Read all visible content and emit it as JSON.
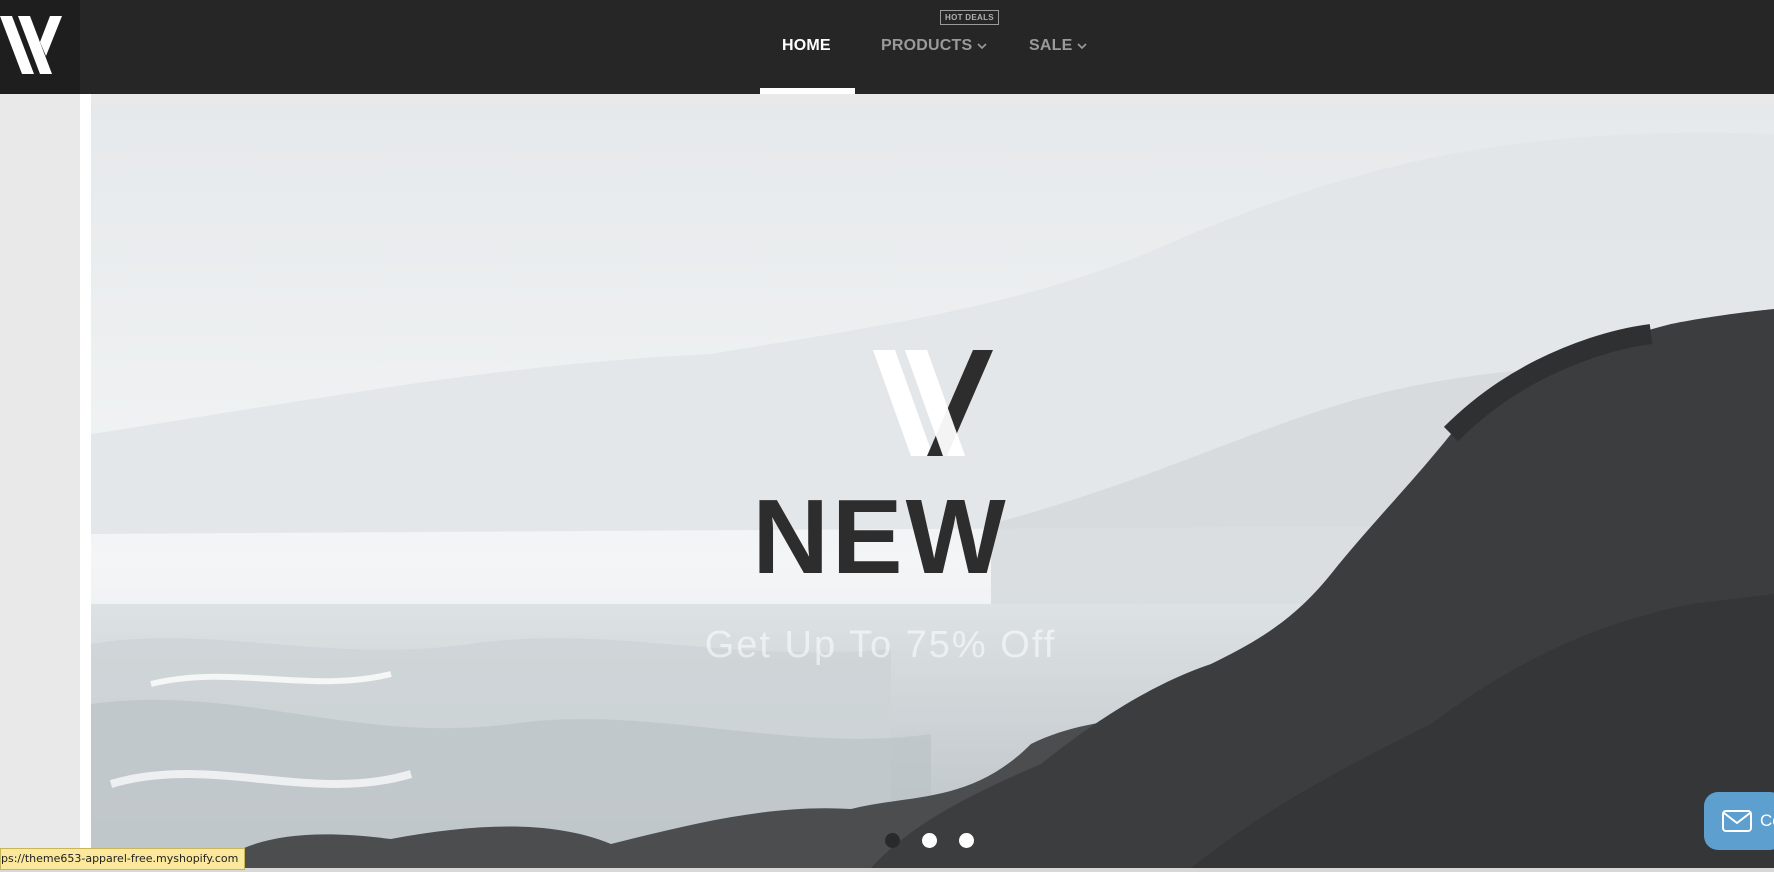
{
  "header": {
    "hot_badge": "HOT DEALS",
    "nav": [
      {
        "label": "HOME",
        "active": true
      },
      {
        "label": "PRODUCTS",
        "dropdown": true
      },
      {
        "label": "SALE",
        "dropdown": true
      }
    ]
  },
  "hero": {
    "title": "NEW",
    "subtitle": "Get Up To 75% Off",
    "slides": 3,
    "active_slide": 1
  },
  "status_url": "ps://theme653-apparel-free.myshopify.com",
  "contact": {
    "label": "Co",
    "icon": "mail-icon"
  },
  "colors": {
    "header_bg": "#262626",
    "accent": "#ffffff",
    "contact_bg": "#5d9fcf"
  }
}
